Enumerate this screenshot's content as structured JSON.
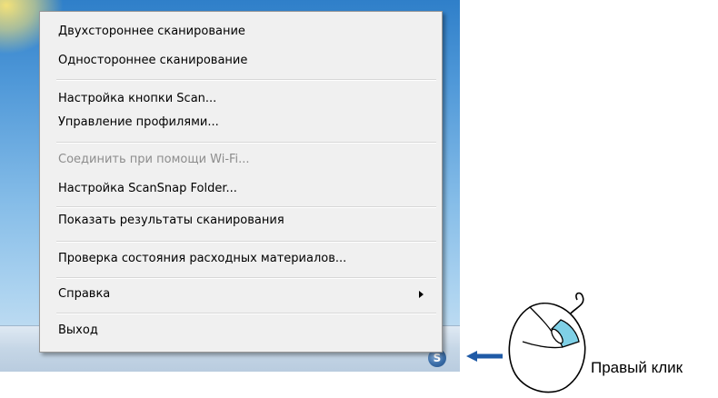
{
  "menu": {
    "items": [
      {
        "label": "Двухстороннее сканирование",
        "enabled": true
      },
      {
        "label": "Одностороннее сканирование",
        "enabled": true
      },
      {
        "label": "Настройка кнопки Scan...",
        "enabled": true
      },
      {
        "label": "Управление профилями...",
        "enabled": true
      },
      {
        "label": "Соединить при помощи Wi-Fi...",
        "enabled": false
      },
      {
        "label": "Настройка ScanSnap Folder...",
        "enabled": true
      },
      {
        "label": "Показать результаты сканирования",
        "enabled": true
      },
      {
        "label": "Проверка состояния расходных материалов...",
        "enabled": true
      },
      {
        "label": "Справка",
        "enabled": true,
        "submenu": true
      },
      {
        "label": "Выход",
        "enabled": true
      }
    ]
  },
  "tray": {
    "icon": "scansnap-manager-icon",
    "glyph": "S"
  },
  "annotation": {
    "caption": "Правый клик",
    "arrow_color": "#1f5aa6",
    "highlight_color": "#7fd0e6"
  }
}
